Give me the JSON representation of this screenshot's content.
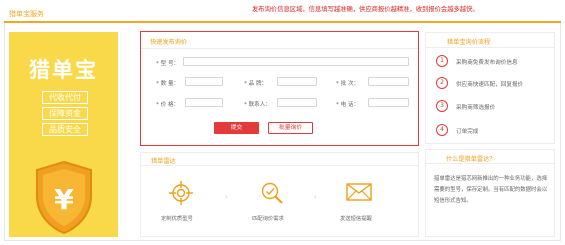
{
  "header": {
    "title": "猎单宝服务"
  },
  "annotation": "发布询价信息区域，信息填写越准确，供应商报价越精准，收到报价会越多越快。",
  "banner": {
    "title": "猎单宝",
    "tags": [
      "代收代付",
      "保障资金",
      "品质安全"
    ],
    "shield_symbol": "¥"
  },
  "form": {
    "title": "快速发布询价",
    "fields": {
      "model": {
        "label": "* 型  号：",
        "value": ""
      },
      "quantity": {
        "label": "* 数  量：",
        "value": ""
      },
      "brand": {
        "label": "* 品  牌：",
        "value": ""
      },
      "batch": {
        "label": "* 批  次：",
        "value": ""
      },
      "price": {
        "label": "* 价  格：",
        "value": ""
      },
      "contact": {
        "label": "* 联系人：",
        "value": ""
      },
      "phone": {
        "label": "* 电  话：",
        "value": ""
      }
    },
    "submit_label": "提交",
    "batch_label": "批量询价"
  },
  "process": {
    "title": "猎单宝询价流程",
    "steps": [
      {
        "num": "1",
        "text": "采购商免费发布询价信息"
      },
      {
        "num": "2",
        "text": "供应商快速匹配，回复报价"
      },
      {
        "num": "3",
        "text": "采购商筛选报价"
      },
      {
        "num": "4",
        "text": "订单完成"
      }
    ]
  },
  "radar": {
    "title": "猎单雷达",
    "items": [
      {
        "label": "定制优质型号",
        "icon": "crosshair-icon"
      },
      {
        "label": "匹配询价需求",
        "icon": "magnifier-icon"
      },
      {
        "label": "发送短信提醒",
        "icon": "envelope-icon"
      }
    ]
  },
  "whatis": {
    "title": "什么是猎单雷达？",
    "description": "猎单雷达是猎芯网新推出的一种业务功能，选择需要的型号，保存定制。当有匹配的数据时会以短信形式告知。"
  },
  "colors": {
    "accent": "#f5a623",
    "red": "#e33a3a",
    "banner": "#f9d949"
  }
}
